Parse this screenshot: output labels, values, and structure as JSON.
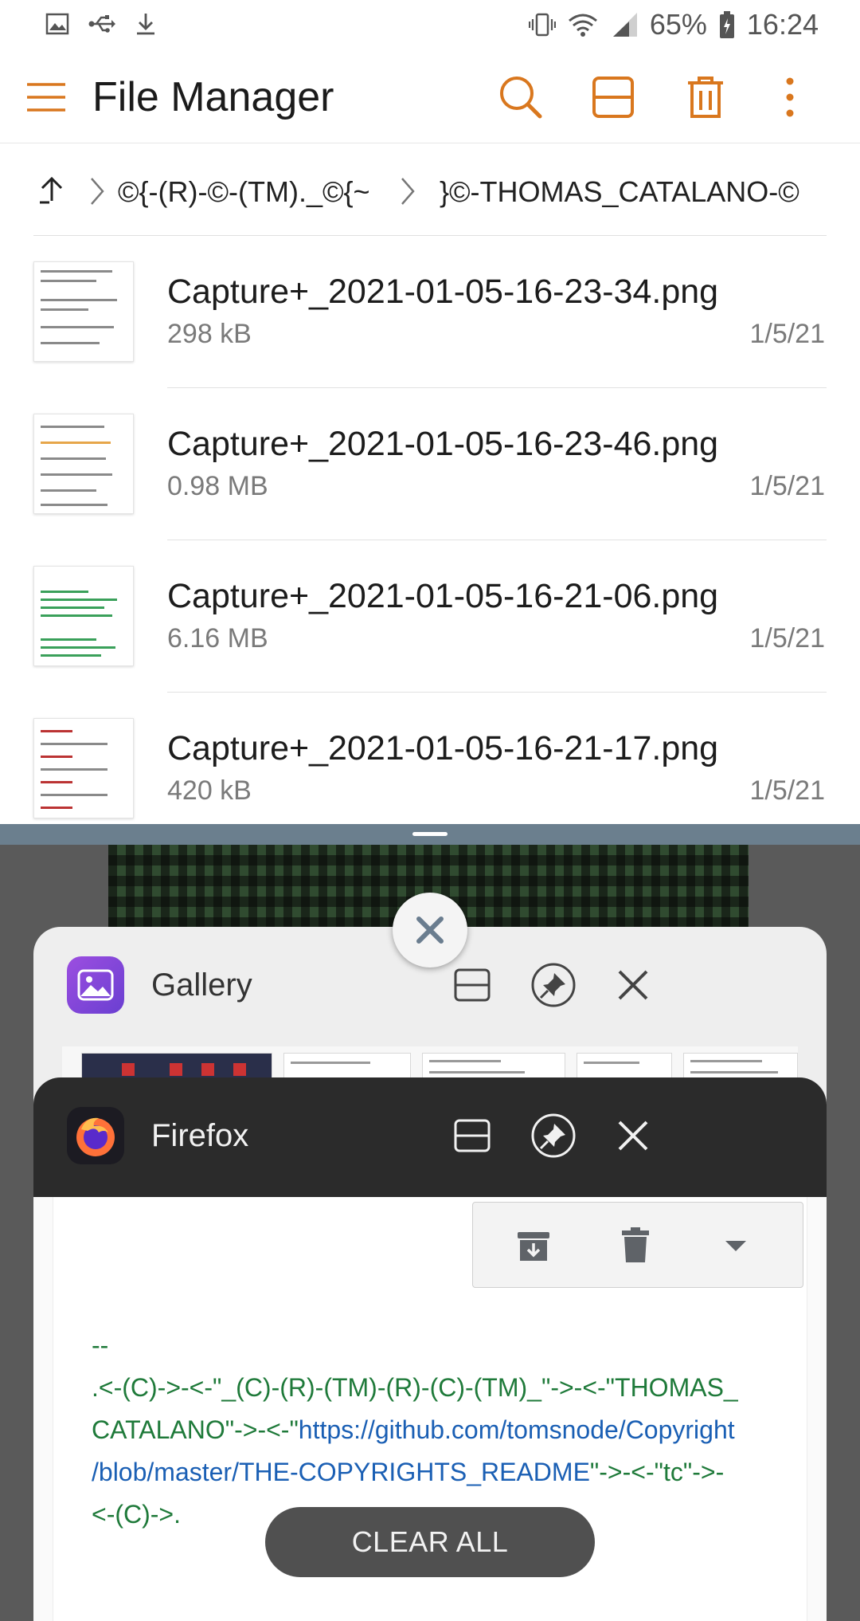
{
  "status_bar": {
    "battery": "65%",
    "time": "16:24",
    "left_icons": [
      "image-icon",
      "usb-icon",
      "download-icon"
    ],
    "right_icons": [
      "vibrate-icon",
      "wifi-icon",
      "signal-icon",
      "battery-icon"
    ]
  },
  "app_bar": {
    "title": "File Manager",
    "accent_color": "#d9771e",
    "actions": [
      "search-icon",
      "split-view-icon",
      "delete-icon",
      "more-icon"
    ]
  },
  "breadcrumb": {
    "segments": [
      "©{-(R)-©-(TM)._©{~",
      "}©-THOMAS_CATALANO-©"
    ]
  },
  "files": [
    {
      "name": "Capture+_2021-01-05-16-23-34.png",
      "size": "298 kB",
      "date": "1/5/21"
    },
    {
      "name": "Capture+_2021-01-05-16-23-46.png",
      "size": "0.98 MB",
      "date": "1/5/21"
    },
    {
      "name": "Capture+_2021-01-05-16-21-06.png",
      "size": "6.16 MB",
      "date": "1/5/21"
    },
    {
      "name": "Capture+_2021-01-05-16-21-17.png",
      "size": "420 kB",
      "date": "1/5/21"
    }
  ],
  "recents": {
    "gallery": {
      "app_name": "Gallery"
    },
    "firefox": {
      "app_name": "Firefox",
      "email_signature": {
        "line1": "--",
        "line2": ".<-(C)->-<-\"_(C)-(R)-(TM)-(R)-(C)-(TM)_\"->-<-\"THOMAS_",
        "line3_prefix": "CATALANO\"->-<-\"",
        "line3_link": "https://github.com/tomsnode/Copyright",
        "line4_link": "/blob/master/THE-COPYRIGHTS_README",
        "line4_suffix": "\"->-<-\"tc\"->-",
        "line5": "<-(C)->."
      }
    },
    "clear_all_label": "CLEAR ALL"
  }
}
